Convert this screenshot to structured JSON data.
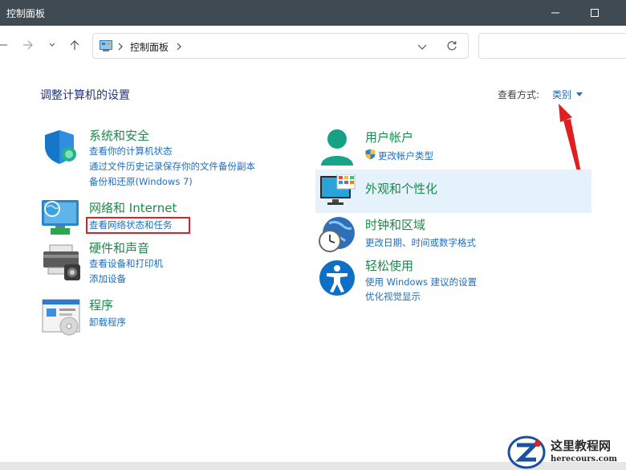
{
  "window": {
    "title": "控制面板"
  },
  "address": {
    "crumb": "控制面板"
  },
  "page": {
    "heading": "调整计算机的设置",
    "view_by_label": "查看方式:",
    "view_by_value": "类别"
  },
  "left_categories": [
    {
      "title": "系统和安全",
      "icon": "shield-icon",
      "links": [
        "查看你的计算机状态",
        "通过文件历史记录保存你的文件备份副本",
        "备份和还原(Windows 7)"
      ]
    },
    {
      "title": "网络和 Internet",
      "icon": "network-monitor-icon",
      "links": [
        "查看网络状态和任务"
      ]
    },
    {
      "title": "硬件和声音",
      "icon": "printer-icon",
      "links": [
        "查看设备和打印机",
        "添加设备"
      ]
    },
    {
      "title": "程序",
      "icon": "programs-icon",
      "links": [
        "卸载程序"
      ]
    }
  ],
  "right_categories": [
    {
      "title": "用户帐户",
      "icon": "user-icon",
      "links": [
        "更改帐户类型"
      ]
    },
    {
      "title": "外观和个性化",
      "icon": "appearance-icon",
      "links": []
    },
    {
      "title": "时钟和区域",
      "icon": "clock-globe-icon",
      "links": [
        "更改日期、时间或数字格式"
      ]
    },
    {
      "title": "轻松使用",
      "icon": "accessibility-icon",
      "links": [
        "使用 Windows 建议的设置",
        "优化视觉显示"
      ]
    }
  ],
  "watermark": {
    "name": "这里教程网",
    "url": "herecours.com"
  },
  "colors": {
    "titlebar": "#3f4a52",
    "category_title": "#1a8a4a",
    "link": "#1c6fc4",
    "heading": "#1e3287",
    "highlight": "#e5f1fb",
    "annotation": "#e02020"
  }
}
